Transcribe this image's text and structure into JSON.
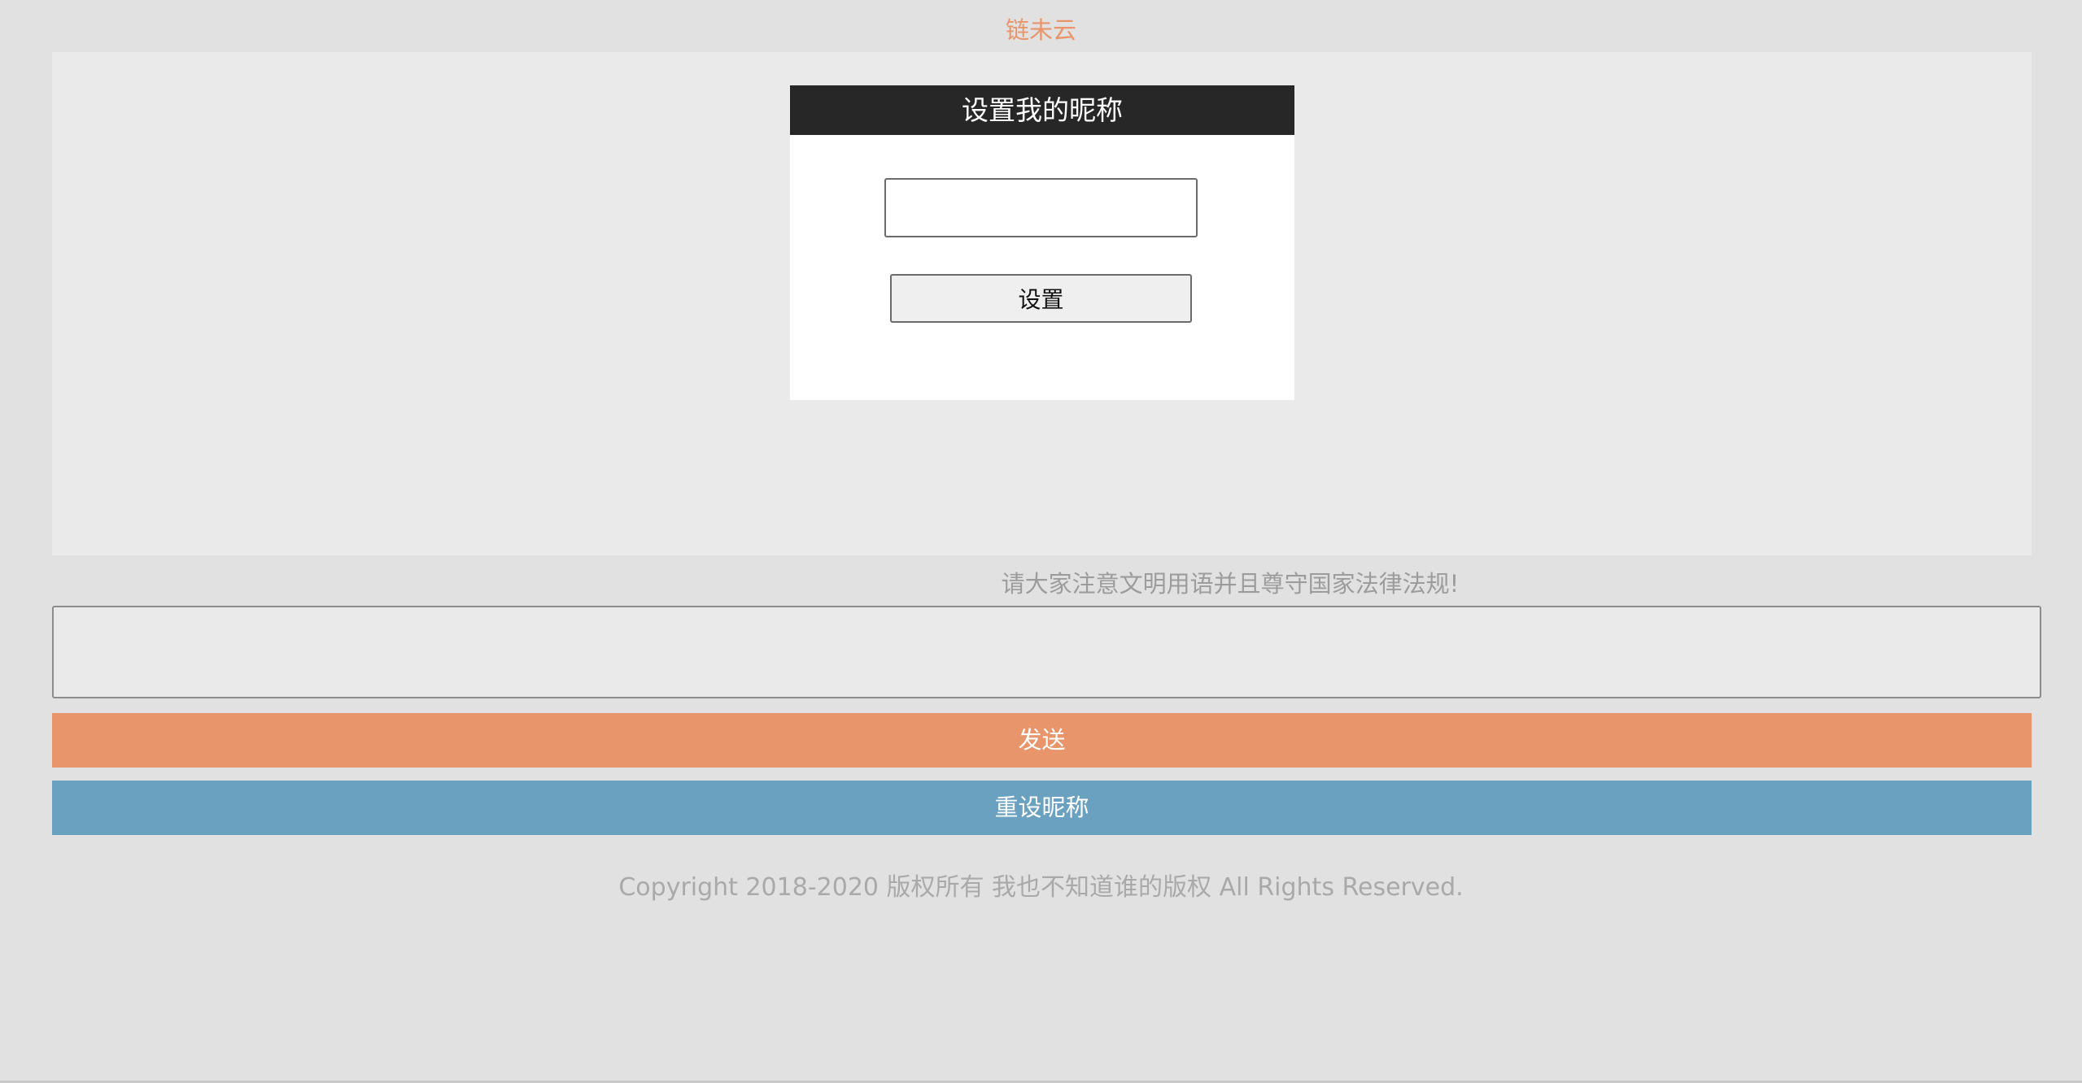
{
  "brand": {
    "title": "链未云"
  },
  "nickname_modal": {
    "title": "设置我的昵称",
    "input_value": "",
    "input_placeholder": "",
    "set_label": "设置"
  },
  "chat": {
    "notice": "请大家注意文明用语并且尊守国家法律法规!",
    "message_value": "",
    "send_label": "发送",
    "reset_nickname_label": "重设昵称"
  },
  "footer": {
    "copyright": "Copyright 2018-2020 版权所有 我也不知道谁的版权 All Rights Reserved."
  },
  "colors": {
    "brand_accent": "#e8956b",
    "send_button": "#e8956b",
    "reset_button": "#6aa1c0",
    "modal_header": "#272727"
  }
}
